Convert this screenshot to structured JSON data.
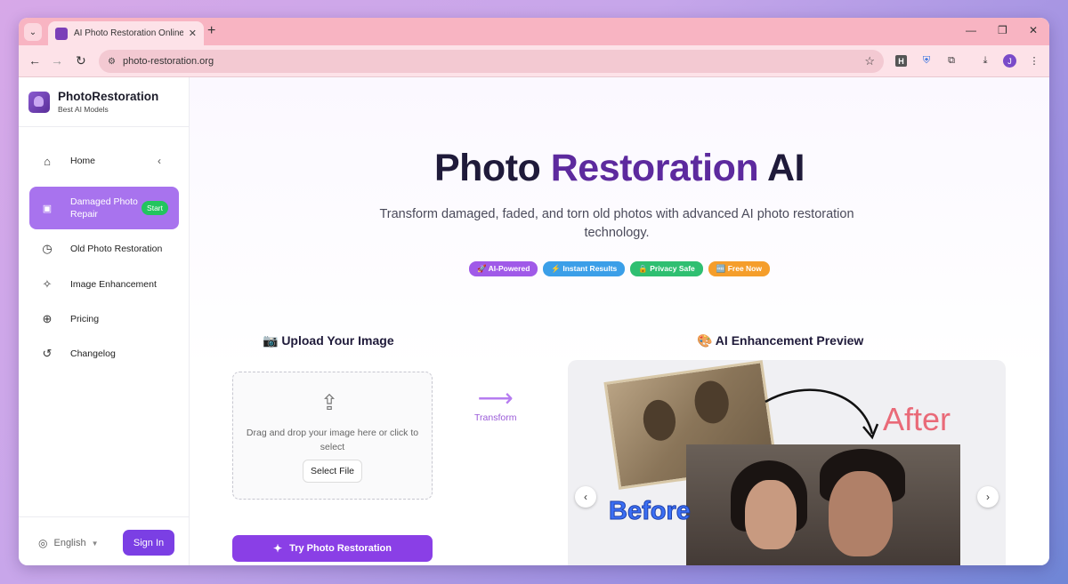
{
  "browser": {
    "tab_title": "AI Photo Restoration Online Fre",
    "url": "photo-restoration.org",
    "profile_initial": "J",
    "ext_h": "H"
  },
  "sidebar": {
    "brand_name": "PhotoRestoration",
    "brand_sub": "Best AI Models",
    "items": [
      {
        "label": "Home",
        "icon": "home-icon"
      },
      {
        "label": "Damaged Photo Repair",
        "icon": "image-icon",
        "badge": "Start"
      },
      {
        "label": "Old Photo Restoration",
        "icon": "clock-icon"
      },
      {
        "label": "Image Enhancement",
        "icon": "sparkles-icon"
      },
      {
        "label": "Pricing",
        "icon": "pricing-icon"
      },
      {
        "label": "Changelog",
        "icon": "history-icon"
      }
    ],
    "language": "English",
    "signin_label": "Sign In"
  },
  "hero": {
    "title_main": "Photo ",
    "title_accent": "Restoration",
    "title_end": " AI",
    "subtitle": "Transform damaged, faded, and torn old photos with advanced AI photo restoration technology.",
    "badges": [
      {
        "label": "🚀 AI-Powered",
        "color": "#a05ae8"
      },
      {
        "label": "⚡ Instant Results",
        "color": "#3b9fe8"
      },
      {
        "label": "🔒 Privacy Safe",
        "color": "#2fbf71"
      },
      {
        "label": "🆓 Free Now",
        "color": "#f59e2b"
      }
    ]
  },
  "upload": {
    "title": "📷 Upload Your Image",
    "drop_text": "Drag and drop your image here or click to select",
    "select_label": "Select File",
    "try_label": "Try Photo Restoration"
  },
  "transform_label": "Transform",
  "preview": {
    "title": "🎨 AI Enhancement Preview",
    "after_label": "After",
    "before_label": "Before"
  }
}
